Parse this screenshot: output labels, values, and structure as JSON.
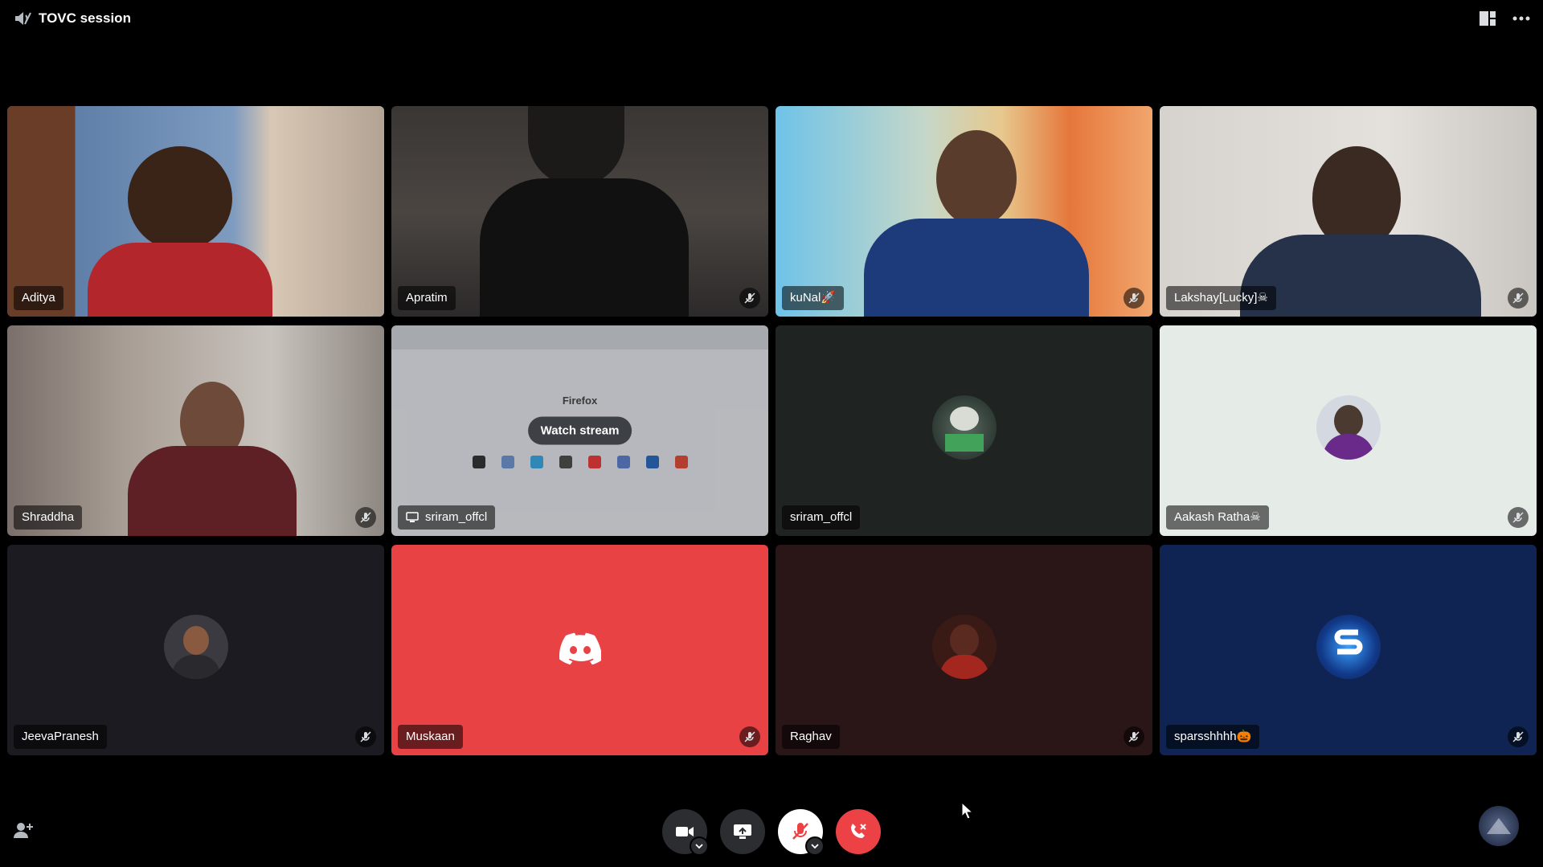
{
  "window": {
    "title": "TOVC session"
  },
  "colors": {
    "speaking_ring": "#23a55a",
    "discord_red": "#ed4245",
    "bar_bg": "#000000"
  },
  "participants": [
    {
      "name": "Aditya",
      "speaking": true,
      "muted": false
    },
    {
      "name": "Apratim",
      "muted": true
    },
    {
      "name": "kuNal🚀",
      "muted": true
    },
    {
      "name": "Lakshay[Lucky]☠",
      "muted": true
    },
    {
      "name": "Shraddha",
      "muted": true
    },
    {
      "name": "sriram_offcl",
      "type": "screen-share",
      "overlay_label": "Watch stream",
      "stream_title": "Firefox",
      "muted": false
    },
    {
      "name": "sriram_offcl",
      "type": "avatar",
      "muted": false
    },
    {
      "name": "Aakash Ratha☠",
      "type": "avatar",
      "muted": true
    },
    {
      "name": "JeevaPranesh",
      "type": "avatar",
      "muted": true
    },
    {
      "name": "Muskaan",
      "type": "avatar",
      "muted": true
    },
    {
      "name": "Raghav",
      "type": "avatar",
      "muted": true
    },
    {
      "name": "sparsshhhh🎃",
      "type": "avatar",
      "muted": true
    }
  ],
  "controls": {
    "camera": "camera-icon",
    "screen_share": "screen-share-icon",
    "mic": "mic-muted-icon",
    "hangup": "hangup-icon"
  }
}
